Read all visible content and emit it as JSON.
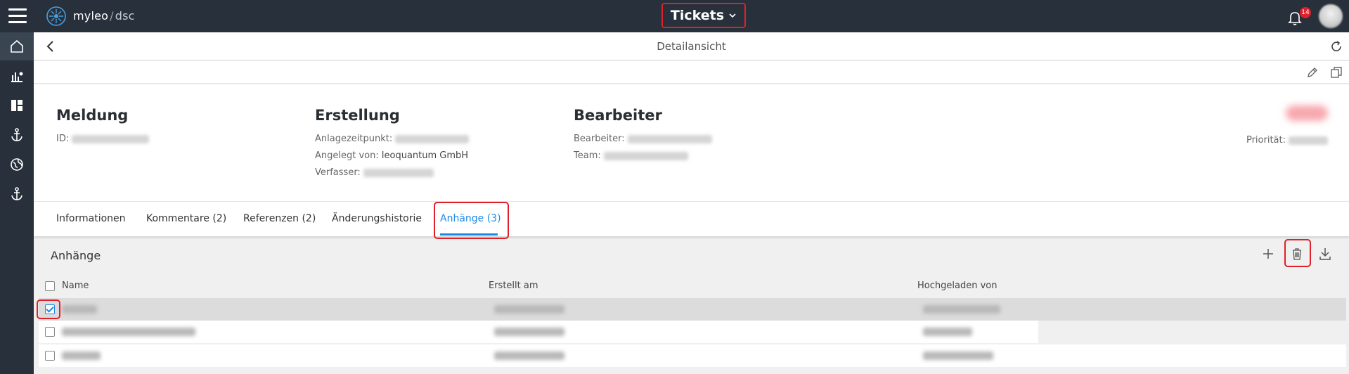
{
  "app": {
    "brand": "myleo",
    "brand_separator": "/",
    "brand_sub": "dsc",
    "module": "Tickets",
    "notification_count": "14"
  },
  "colors": {
    "topbar": "#27303b",
    "accent": "#1e88e5",
    "highlight": "#e0202a"
  },
  "icons": [
    "menu-icon",
    "logo-icon",
    "chevron-down-icon",
    "bell-icon",
    "home-icon",
    "chart-icon",
    "dashboard-icon",
    "anchor-icon",
    "globe-icon",
    "back-icon",
    "refresh-icon",
    "edit-icon",
    "copy-icon",
    "plus-icon",
    "trash-icon",
    "download-icon"
  ],
  "page": {
    "title": "Detailansicht"
  },
  "detail": {
    "meldung": {
      "heading": "Meldung",
      "id_label": "ID:"
    },
    "erstellung": {
      "heading": "Erstellung",
      "anlage_label": "Anlagezeitpunkt:",
      "angelegt_label": "Angelegt von:",
      "angelegt_value": "leoquantum GmbH",
      "verfasser_label": "Verfasser:"
    },
    "bearbeiter": {
      "heading": "Bearbeiter",
      "bearbeiter_label": "Bearbeiter:",
      "team_label": "Team:"
    },
    "prioritaet_label": "Priorität:"
  },
  "tabs": [
    {
      "label": "Informationen"
    },
    {
      "label": "Kommentare (2)"
    },
    {
      "label": "Referenzen (2)"
    },
    {
      "label": "Änderungshistorie"
    },
    {
      "label": "Anhänge (3)",
      "active": true
    }
  ],
  "attachments": {
    "title": "Anhänge",
    "columns": [
      "Name",
      "Erstellt am",
      "Hochgeladen von"
    ],
    "rows": [
      {
        "selected": true
      },
      {
        "selected": false
      },
      {
        "selected": false
      }
    ]
  }
}
